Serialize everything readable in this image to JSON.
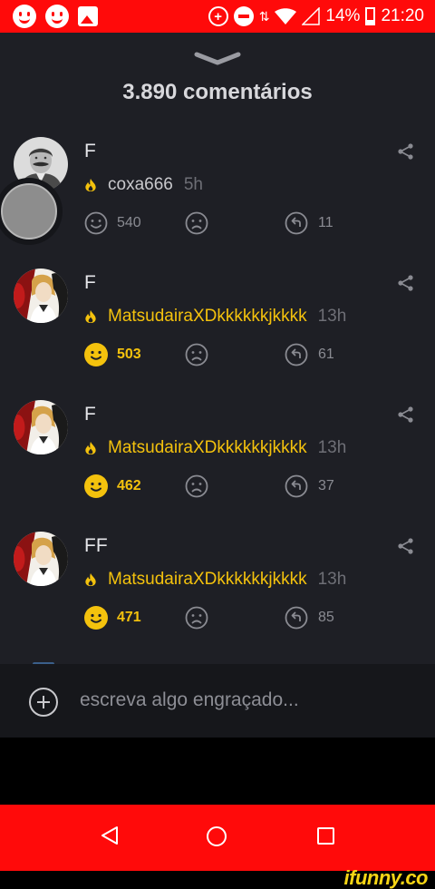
{
  "status_bar": {
    "battery": "14%",
    "time": "21:20",
    "data_glyph": "⇅",
    "location_glyph": "+"
  },
  "header": {
    "title": "3.890 comentários"
  },
  "colors": {
    "status_bar": "#ff0a0a",
    "sheet_bg": "#1e1f25",
    "gold": "#f4c20d",
    "muted_text": "#8a8b92"
  },
  "comments": [
    {
      "text": "F",
      "author": "coxa666",
      "time": "5h",
      "likes": "540",
      "liked": false,
      "replies": "11",
      "avatar": "stalin-portrait-avatar"
    },
    {
      "text": "F",
      "author": "MatsudairaXDkkkkkkjkkkk",
      "time": "13h",
      "likes": "503",
      "liked": true,
      "replies": "61",
      "avatar": "death-note-avatar"
    },
    {
      "text": "F",
      "author": "MatsudairaXDkkkkkkjkkkk",
      "time": "13h",
      "likes": "462",
      "liked": true,
      "replies": "37",
      "avatar": "death-note-avatar"
    },
    {
      "text": "FF",
      "author": "MatsudairaXDkkkkkkjkkkk",
      "time": "13h",
      "likes": "471",
      "liked": true,
      "replies": "85",
      "avatar": "death-note-avatar"
    }
  ],
  "input": {
    "placeholder": "escreva algo engraçado..."
  },
  "watermark": "ifunny.co",
  "icons": [
    "smile-icon",
    "sad-icon",
    "reply-icon",
    "share-icon",
    "flame-icon",
    "chevron-down-icon",
    "plus-circle-icon"
  ]
}
